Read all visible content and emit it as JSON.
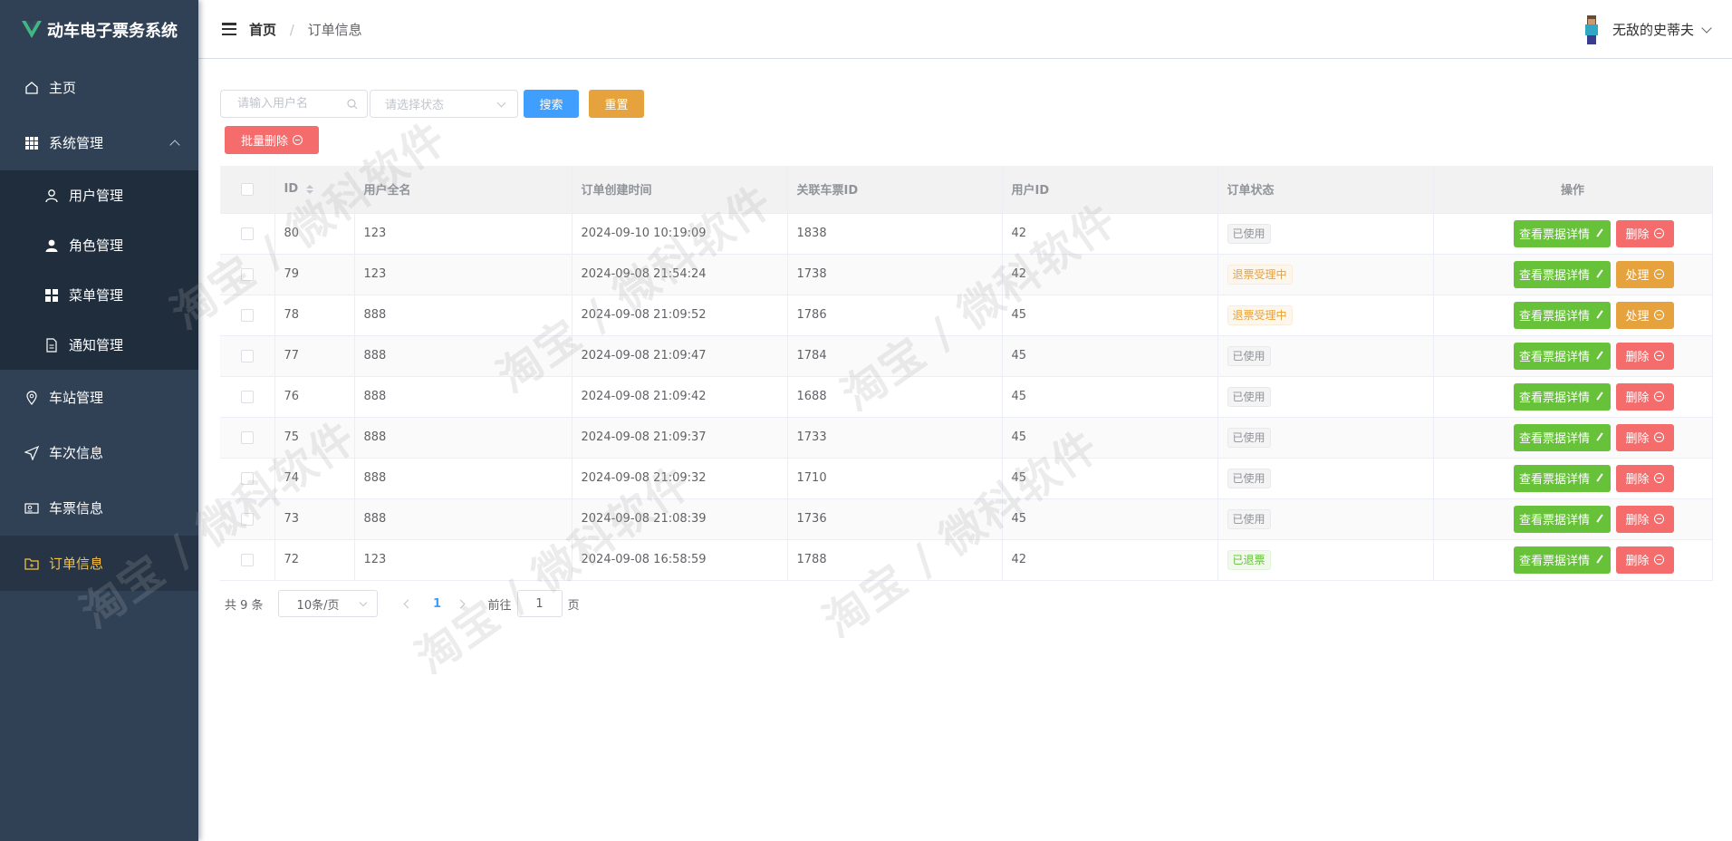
{
  "app": {
    "title": "动车电子票务系统"
  },
  "sidebar": {
    "items": [
      {
        "label": "主页",
        "icon": "home-icon"
      },
      {
        "label": "系统管理",
        "icon": "grid-icon",
        "expanded": true
      },
      {
        "label": "用户管理",
        "icon": "user-icon"
      },
      {
        "label": "角色管理",
        "icon": "person-fill-icon"
      },
      {
        "label": "菜单管理",
        "icon": "menu-icon"
      },
      {
        "label": "通知管理",
        "icon": "document-icon"
      },
      {
        "label": "车站管理",
        "icon": "location-icon"
      },
      {
        "label": "车次信息",
        "icon": "send-icon"
      },
      {
        "label": "车票信息",
        "icon": "ticket-icon"
      },
      {
        "label": "订单信息",
        "icon": "folder-icon",
        "active": true
      }
    ]
  },
  "header": {
    "breadcrumb": {
      "home": "首页",
      "separator": "/",
      "current": "订单信息"
    },
    "user_name": "无敌的史蒂夫"
  },
  "filters": {
    "username_placeholder": "请输入用户名",
    "status_placeholder": "请选择状态",
    "search_label": "搜索",
    "reset_label": "重置",
    "batch_delete_label": "批量删除"
  },
  "table": {
    "columns": [
      "ID",
      "用户全名",
      "订单创建时间",
      "关联车票ID",
      "用户ID",
      "订单状态",
      "操作"
    ],
    "view_label": "查看票据详情",
    "rows": [
      {
        "id": "80",
        "name": "123",
        "created": "2024-09-10 10:19:09",
        "ticket_id": "1838",
        "user_id": "42",
        "status": "已使用",
        "status_type": "info",
        "action": "删除"
      },
      {
        "id": "79",
        "name": "123",
        "created": "2024-09-08 21:54:24",
        "ticket_id": "1738",
        "user_id": "42",
        "status": "退票受理中",
        "status_type": "warning",
        "action": "处理"
      },
      {
        "id": "78",
        "name": "888",
        "created": "2024-09-08 21:09:52",
        "ticket_id": "1786",
        "user_id": "45",
        "status": "退票受理中",
        "status_type": "warning",
        "action": "处理"
      },
      {
        "id": "77",
        "name": "888",
        "created": "2024-09-08 21:09:47",
        "ticket_id": "1784",
        "user_id": "45",
        "status": "已使用",
        "status_type": "info",
        "action": "删除"
      },
      {
        "id": "76",
        "name": "888",
        "created": "2024-09-08 21:09:42",
        "ticket_id": "1688",
        "user_id": "45",
        "status": "已使用",
        "status_type": "info",
        "action": "删除"
      },
      {
        "id": "75",
        "name": "888",
        "created": "2024-09-08 21:09:37",
        "ticket_id": "1733",
        "user_id": "45",
        "status": "已使用",
        "status_type": "info",
        "action": "删除"
      },
      {
        "id": "74",
        "name": "888",
        "created": "2024-09-08 21:09:32",
        "ticket_id": "1710",
        "user_id": "45",
        "status": "已使用",
        "status_type": "info",
        "action": "删除"
      },
      {
        "id": "73",
        "name": "888",
        "created": "2024-09-08 21:08:39",
        "ticket_id": "1736",
        "user_id": "45",
        "status": "已使用",
        "status_type": "info",
        "action": "删除"
      },
      {
        "id": "72",
        "name": "123",
        "created": "2024-09-08 16:58:59",
        "ticket_id": "1788",
        "user_id": "42",
        "status": "已退票",
        "status_type": "success",
        "action": "删除"
      }
    ]
  },
  "pagination": {
    "total_text": "共 9 条",
    "page_size": "10条/页",
    "current_page": "1",
    "goto_prefix": "前往",
    "goto_value": "1",
    "goto_suffix": "页"
  },
  "watermark": {
    "text": "淘宝 / 微科软件"
  },
  "colors": {
    "sidebar_bg": "#304156",
    "sidebar_active_text": "#f5c044",
    "primary": "#409eff",
    "warning": "#e6a23c",
    "danger": "#f56c6c",
    "success": "#67c23a"
  }
}
